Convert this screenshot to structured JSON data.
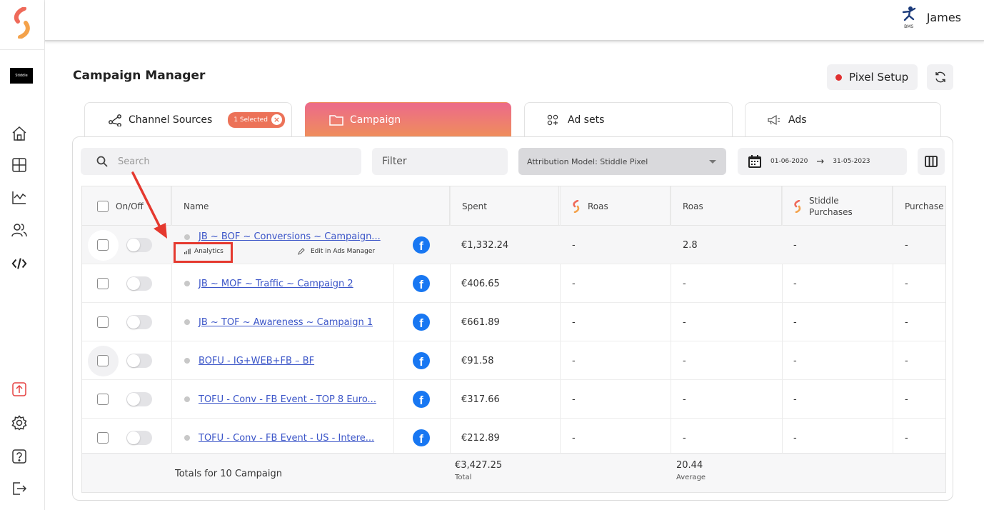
{
  "user": {
    "name": "James",
    "logo_text": "BMS"
  },
  "sidebar": {
    "brand_text": "Stiddle"
  },
  "page": {
    "title": "Campaign Manager",
    "pixel_setup": "Pixel Setup"
  },
  "tabs": [
    {
      "label": "Channel Sources",
      "badge": "1 Selected"
    },
    {
      "label": "Campaign"
    },
    {
      "label": "Ad sets"
    },
    {
      "label": "Ads"
    }
  ],
  "toolbar": {
    "search_placeholder": "Search",
    "filter": "Filter",
    "attribution": "Attribution Model: Stiddle Pixel",
    "date_from": "01-06-2020",
    "date_to": "31-05-2023"
  },
  "table": {
    "headers": {
      "onoff": "On/Off",
      "name": "Name",
      "spent": "Spent",
      "sroas": "Roas",
      "roas": "Roas",
      "spurch1": "Stiddle",
      "spurch2": "Purchases",
      "purchase": "Purchase"
    },
    "row_actions": {
      "analytics": "Analytics",
      "edit": "Edit in Ads Manager"
    },
    "rows": [
      {
        "name": "JB ~ BOF ~ Conversions ~ Campaign...",
        "spent": "€1,332.24",
        "sroas": "-",
        "roas": "2.8",
        "spurch": "-",
        "purchase": "-"
      },
      {
        "name": "JB ~ MOF ~ Traffic ~ Campaign 2",
        "spent": "€406.65",
        "sroas": "-",
        "roas": "-",
        "spurch": "-",
        "purchase": "-"
      },
      {
        "name": "JB ~ TOF ~ Awareness ~ Campaign 1",
        "spent": "€661.89",
        "sroas": "-",
        "roas": "-",
        "spurch": "-",
        "purchase": "-"
      },
      {
        "name": "BOFU - IG+WEB+FB – BF",
        "spent": "€91.58",
        "sroas": "-",
        "roas": "-",
        "spurch": "-",
        "purchase": "-"
      },
      {
        "name": "TOFU - Conv - FB Event - TOP 8 Euro...",
        "spent": "€317.66",
        "sroas": "-",
        "roas": "-",
        "spurch": "-",
        "purchase": "-"
      },
      {
        "name": "TOFU - Conv - FB Event - US - Intere...",
        "spent": "€212.89",
        "sroas": "-",
        "roas": "-",
        "spurch": "-",
        "purchase": "-"
      }
    ],
    "totals": {
      "label": "Totals for 10 Campaign",
      "spent": "€3,427.25",
      "spent_sub": "Total",
      "roas": "20.44",
      "roas_sub": "Average"
    }
  },
  "colors": {
    "accent": "#ec7258",
    "link": "#3b55c8",
    "facebook": "#1877f2",
    "annotation": "#e5392f"
  }
}
